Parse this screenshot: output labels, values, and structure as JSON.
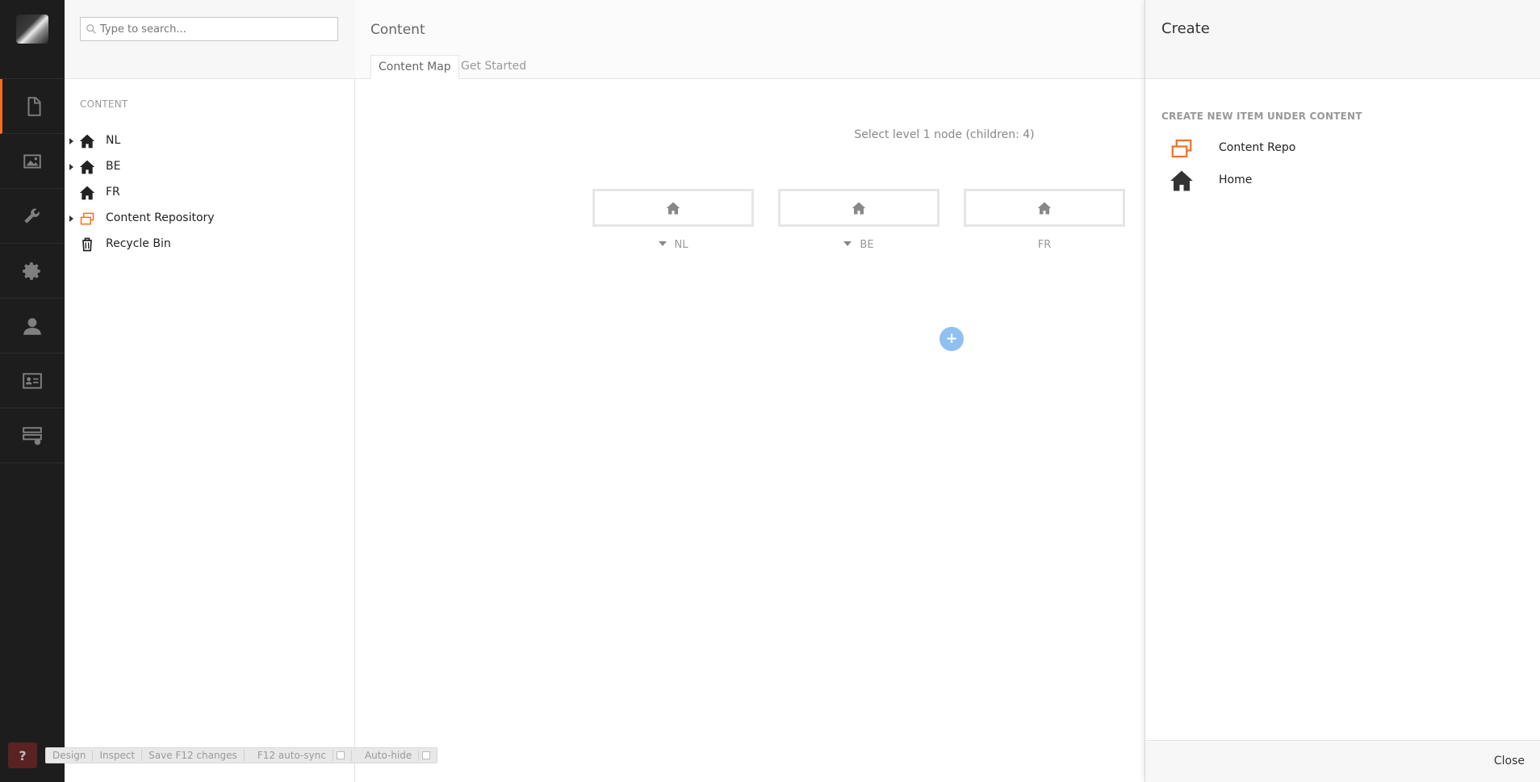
{
  "tree": {
    "search_placeholder": "Type to search...",
    "heading": "CONTENT",
    "items": [
      {
        "label": "NL",
        "icon": "home-icon",
        "expandable": true
      },
      {
        "label": "BE",
        "icon": "home-icon",
        "expandable": true
      },
      {
        "label": "FR",
        "icon": "home-icon",
        "expandable": false
      },
      {
        "label": "Content Repository",
        "icon": "windows-icon",
        "expandable": true
      },
      {
        "label": "Recycle Bin",
        "icon": "trash-icon",
        "expandable": false
      }
    ]
  },
  "nav": {
    "items": [
      "content-icon",
      "media-icon",
      "settings-wrench-icon",
      "gear-icon",
      "user-icon",
      "member-card-icon",
      "forms-icon"
    ],
    "active": "content-icon",
    "accent": "#f37021"
  },
  "main": {
    "title": "Content",
    "tabs": [
      {
        "label": "Content Map",
        "active": true
      },
      {
        "label": "Get Started",
        "active": false
      }
    ],
    "select_level": "Select level 1 node (children: 4)",
    "nodes": [
      {
        "label": "NL",
        "has_children": true
      },
      {
        "label": "BE",
        "has_children": true
      },
      {
        "label": "FR",
        "has_children": false
      }
    ],
    "add_symbol": "+"
  },
  "create": {
    "title": "Create",
    "subtitle": "CREATE NEW ITEM UNDER CONTENT",
    "items": [
      {
        "label": "Content Repo",
        "icon": "windows-icon",
        "color": "#f37021"
      },
      {
        "label": "Home",
        "icon": "home-icon",
        "color": "#333333"
      }
    ],
    "close_label": "Close"
  },
  "devbar": {
    "logo_symbol": "?",
    "design": "Design",
    "inspect": "Inspect",
    "save": "Save F12 changes",
    "autosync": "F12 auto-sync",
    "autohide": "Auto-hide"
  }
}
